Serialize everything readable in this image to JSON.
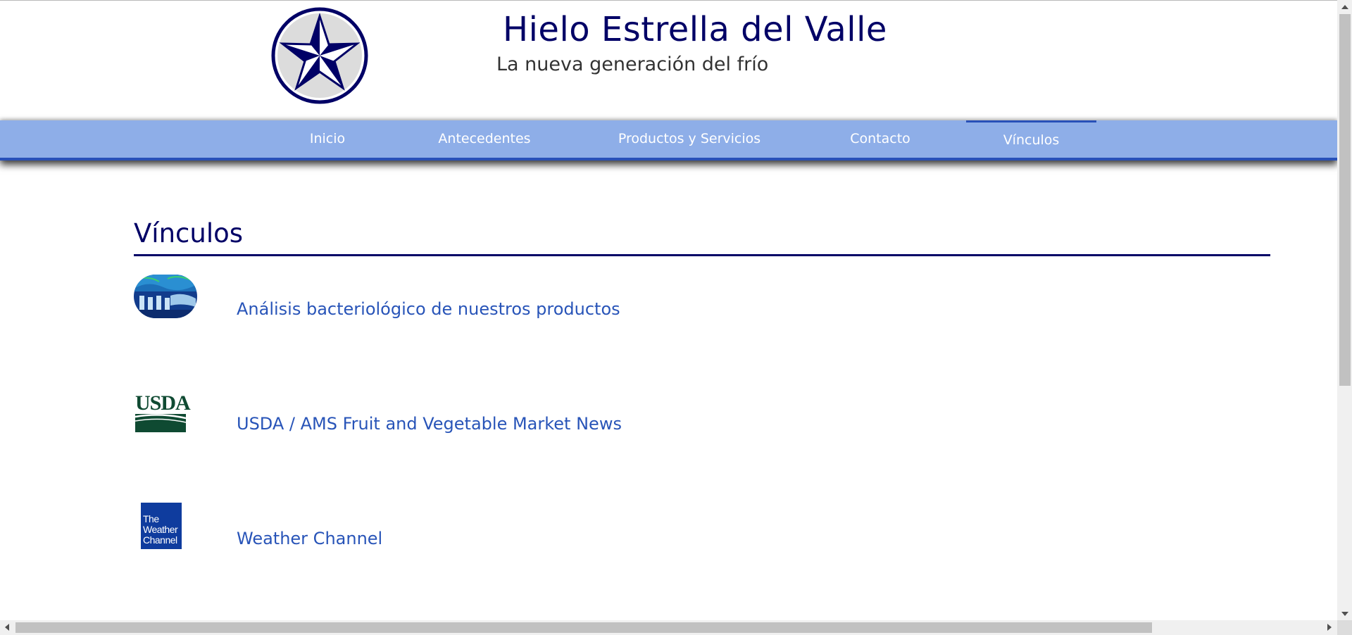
{
  "header": {
    "title": "Hielo Estrella del Valle",
    "subtitle": "La nueva generación del frío",
    "logo_icon": "compass-star-logo"
  },
  "nav": {
    "items": [
      {
        "label": "Inicio",
        "active": false
      },
      {
        "label": "Antecedentes",
        "active": false
      },
      {
        "label": "Productos y Servicios",
        "active": false
      },
      {
        "label": "Contacto",
        "active": false
      },
      {
        "label": "Vínculos",
        "active": true
      }
    ]
  },
  "main": {
    "section_title": "Vínculos",
    "links": [
      {
        "label": "Análisis bacteriológico de nuestros productos",
        "icon": "lab-analysis-thumbnail"
      },
      {
        "label": "USDA / AMS Fruit and Vegetable Market News",
        "icon": "usda-logo",
        "logo_text": "USDA"
      },
      {
        "label": "Weather Channel",
        "icon": "weather-channel-logo",
        "logo_lines": [
          "The",
          "Weather",
          "Channel"
        ]
      }
    ]
  },
  "colors": {
    "title": "#000066",
    "nav_background": "#8eaee8",
    "nav_accent": "#2850b8",
    "link": "#2854b8"
  }
}
